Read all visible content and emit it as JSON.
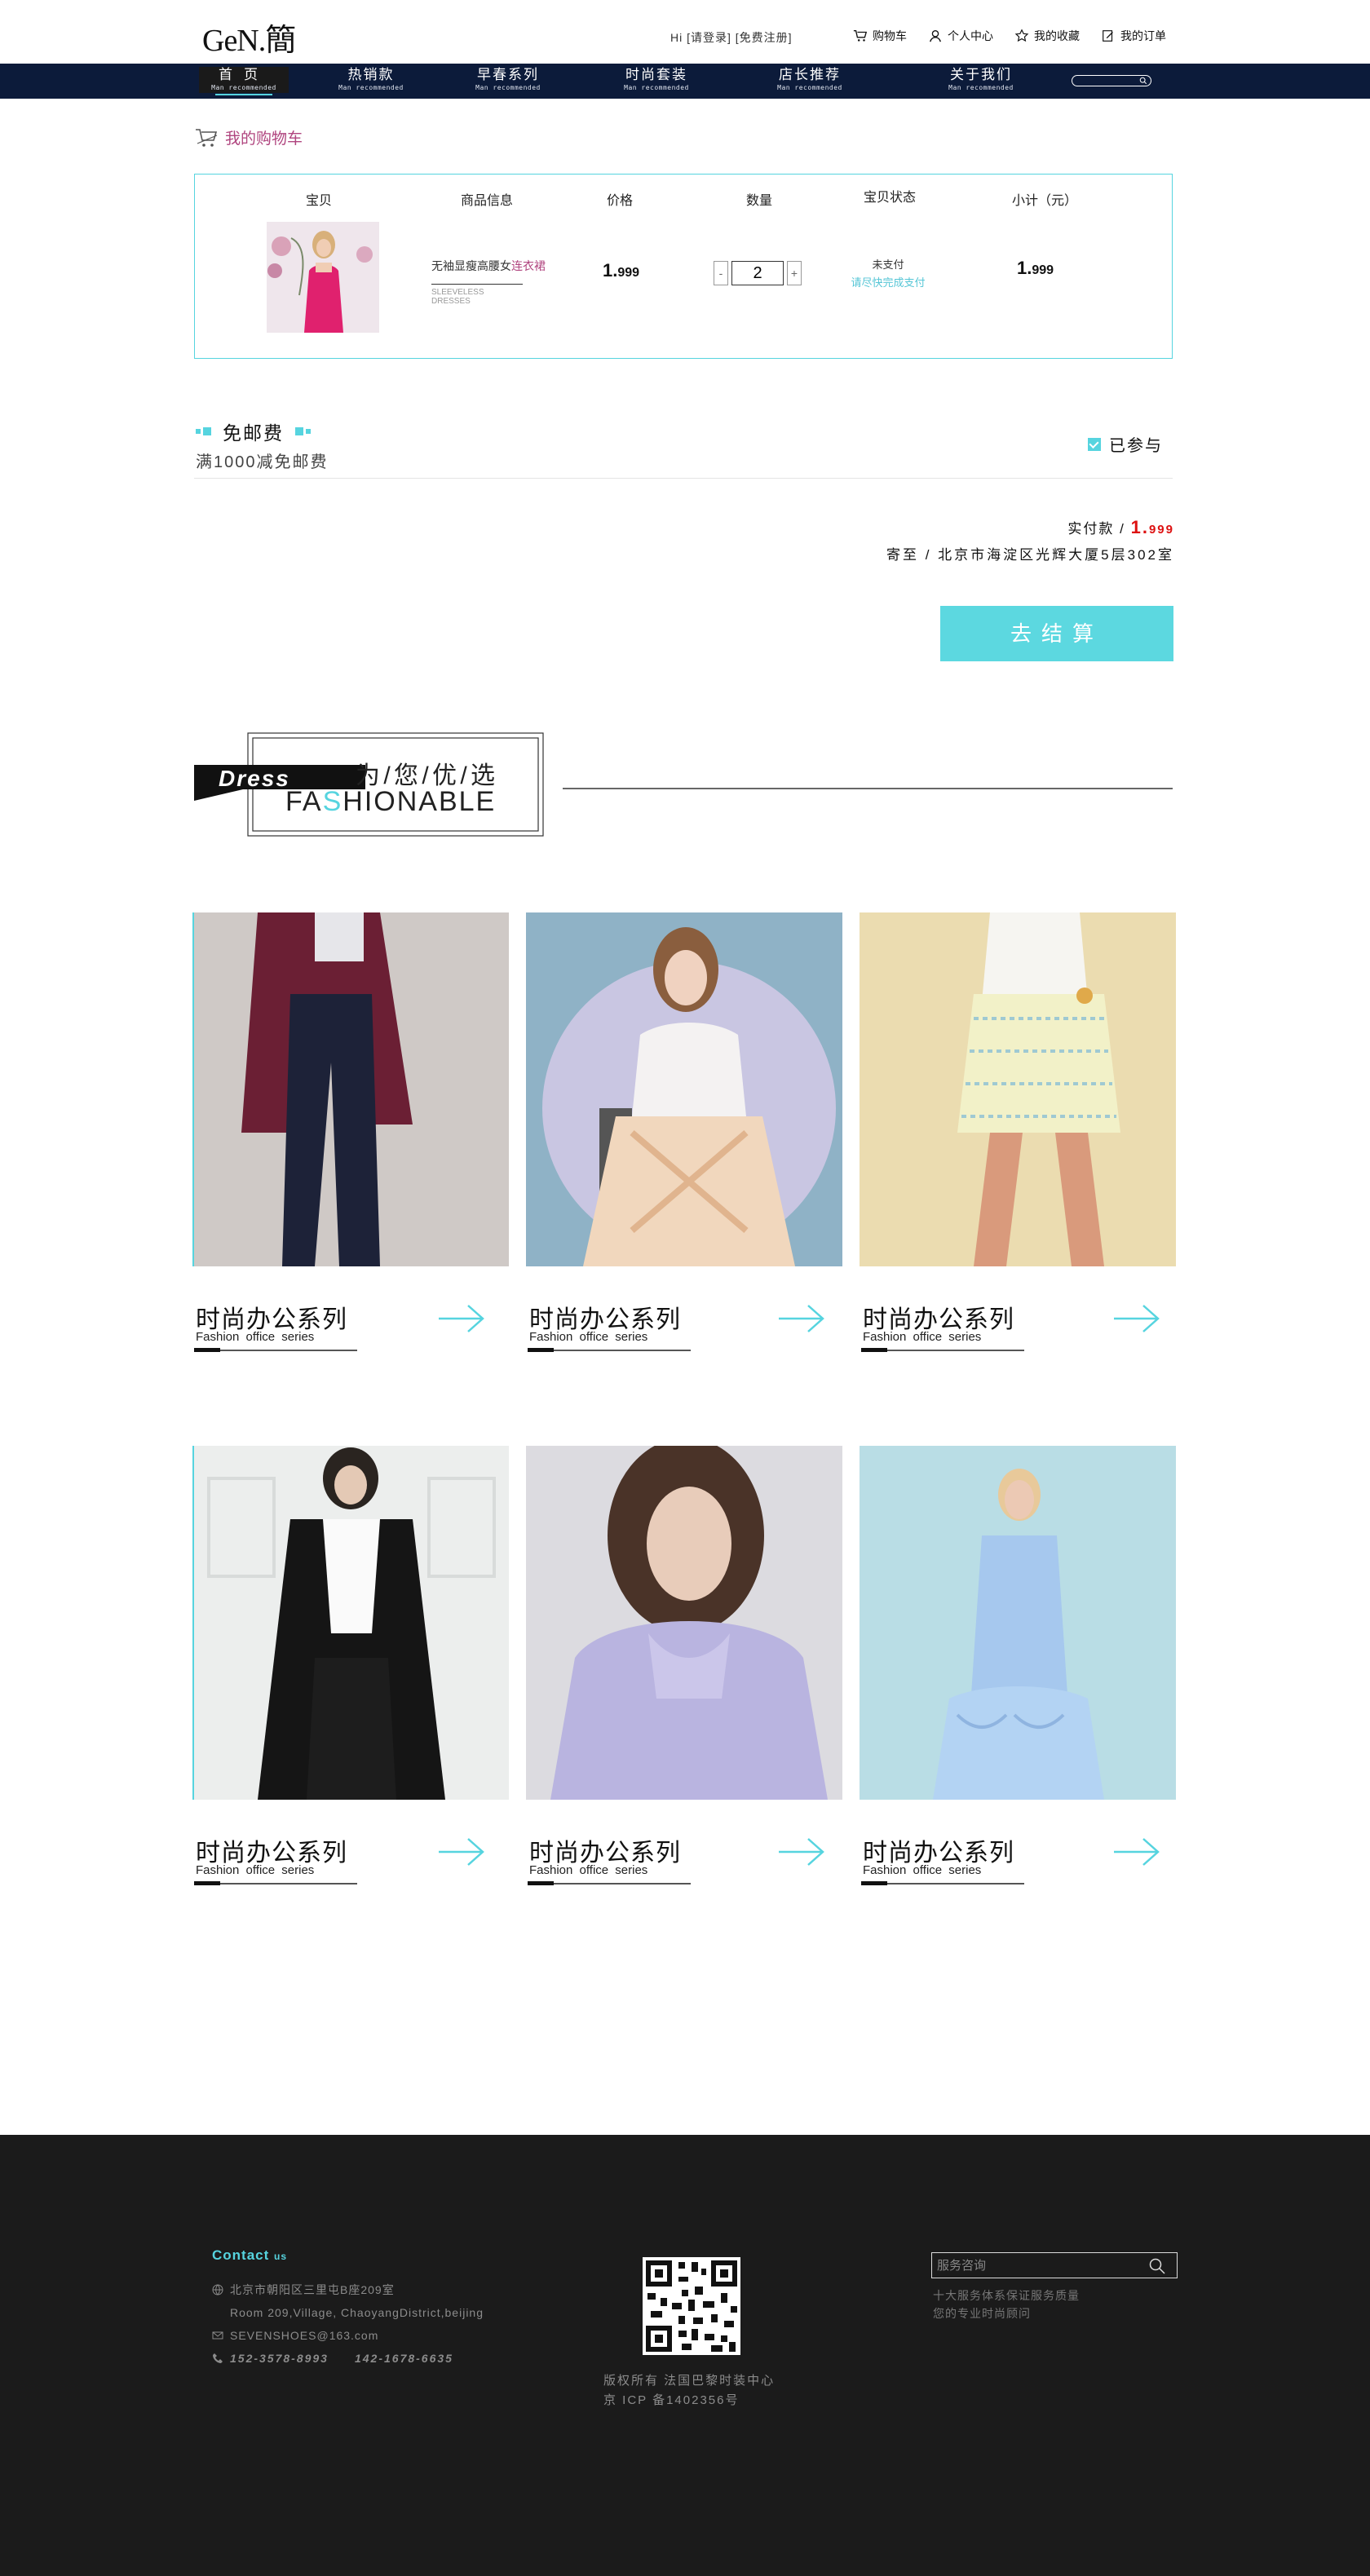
{
  "header": {
    "logo": "GeN.簡",
    "greeting": "Hi",
    "login": "[请登录]",
    "register": "[免费注册]",
    "links": [
      {
        "label": "购物车",
        "icon": "cart-icon"
      },
      {
        "label": "个人中心",
        "icon": "user-icon"
      },
      {
        "label": "我的收藏",
        "icon": "star-icon"
      },
      {
        "label": "我的订单",
        "icon": "order-icon"
      }
    ]
  },
  "nav": {
    "items": [
      {
        "label": "首页",
        "sub": "Man recommended"
      },
      {
        "label": "热销款",
        "sub": "Man recommended"
      },
      {
        "label": "早春系列",
        "sub": "Man recommended"
      },
      {
        "label": "时尚套装",
        "sub": "Man recommended"
      },
      {
        "label": "店长推荐",
        "sub": "Man recommended"
      },
      {
        "label": "关于我们",
        "sub": "Man recommended"
      }
    ],
    "active_index": 0
  },
  "cart": {
    "title": "我的购物车",
    "columns": [
      "宝贝",
      "商品信息",
      "价格",
      "数量",
      "宝贝状态",
      "小计（元）"
    ],
    "item": {
      "name": "无袖显瘦高腰女",
      "name_highlight": "连衣裙",
      "name_en": "SLEEVELESS DRESSES",
      "price_int": "1.",
      "price_dec": "999",
      "qty_minus": "-",
      "qty_plus": "+",
      "quantity": "2",
      "status": "未支付",
      "pay_link": "请尽快完成支付",
      "subtotal_int": "1.",
      "subtotal_dec": "999"
    }
  },
  "shipping": {
    "title": "免邮费",
    "subtitle": "满1000减免邮费",
    "joined": "已参与"
  },
  "summary": {
    "pay_label": "实付款  /",
    "pay_int": "1.",
    "pay_dec": "999",
    "address": "寄至 /  北京市海淀区光辉大厦5层302室",
    "checkout": "去结算"
  },
  "banner": {
    "word": "Dress",
    "cn": "为 / 您 / 优 / 选",
    "en_pre": "FA",
    "en_hl": "S",
    "en_post": "HIONABLE"
  },
  "products": [
    {
      "title": "时尚办公系列",
      "subtitle": "Fashion office series"
    },
    {
      "title": "时尚办公系列",
      "subtitle": "Fashion office series"
    },
    {
      "title": "时尚办公系列",
      "subtitle": "Fashion office series"
    },
    {
      "title": "时尚办公系列",
      "subtitle": "Fashion office series"
    },
    {
      "title": "时尚办公系列",
      "subtitle": "Fashion office series"
    },
    {
      "title": "时尚办公系列",
      "subtitle": "Fashion office series"
    }
  ],
  "footer": {
    "contact_title": "Contact",
    "contact_sub": "us",
    "address_cn": "北京市朝阳区三里屯B座209室",
    "address_en": "Room 209,Village, ChaoyangDistrict,beijing",
    "email": "SEVENSHOES@163.com",
    "phone1": "152-3578-8993",
    "phone2": "142-1678-6635",
    "copyright": "版权所有  法国巴黎时装中心",
    "icp": "京 ICP 备1402356号",
    "service_placeholder": "服务咨询",
    "service_line1": "十大服务体系保证服务质量",
    "service_line2": "您的专业时尚顾问"
  },
  "colors": {
    "accent": "#56d4df",
    "nav": "#0c1b3a",
    "footer": "#1b1b1b",
    "price_red": "#dd1111",
    "brand_pink": "#b0457f"
  }
}
